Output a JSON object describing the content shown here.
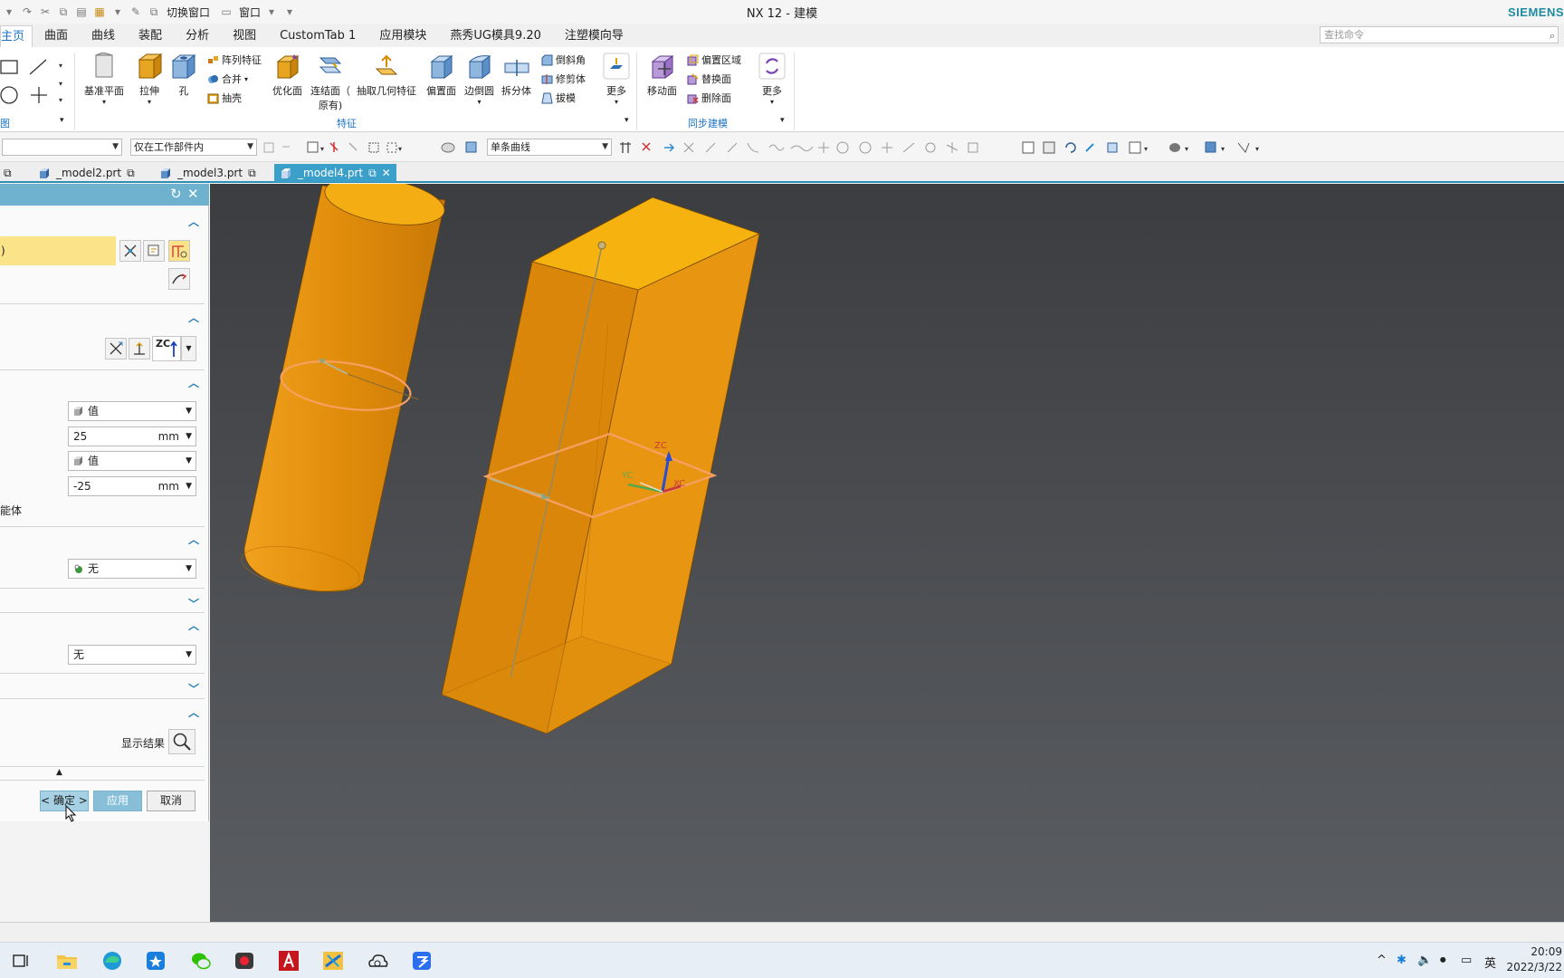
{
  "window": {
    "title": "NX 12 - 建模",
    "brand": "SIEMENS",
    "qa_switch_window": "切换窗口",
    "qa_window": "窗口"
  },
  "ribbon_tabs": [
    "主页",
    "曲面",
    "曲线",
    "装配",
    "分析",
    "视图",
    "CustomTab 1",
    "应用模块",
    "燕秀UG模具9.20",
    "注塑模向导"
  ],
  "command_search_placeholder": "查找命令",
  "ribbon": {
    "sketch_group_label": "图",
    "feature_group_label": "特征",
    "sync_group_label": "同步建模",
    "datum_plane": "基准平面",
    "extrude": "拉伸",
    "hole": "孔",
    "pattern_feature": "阵列特征",
    "unite": "合并",
    "shell": "抽壳",
    "optimize_face": "优化面",
    "chain_face_line1": "连结面（",
    "chain_face_line2": "原有)",
    "extract_geometry": "抽取几何特征",
    "offset_face": "偏置面",
    "edge_blend_face": "边倒圆",
    "split_body": "拆分体",
    "chamfer": "倒斜角",
    "trim_body": "修剪体",
    "draft": "拔模",
    "more": "更多",
    "move_face": "移动面",
    "offset_region": "偏置区域",
    "replace_face": "替换面",
    "delete_face": "删除面",
    "more2": "更多"
  },
  "toolbar": {
    "filter_scope": "仅在工作部件内",
    "curve_rule": "单条曲线"
  },
  "doc_tabs": [
    "_model2.prt",
    "_model3.prt",
    "_model4.prt"
  ],
  "dialog": {
    "selection_text": ")",
    "zc_label": "ZC",
    "start_type": "值",
    "start_distance": "25",
    "start_unit": "mm",
    "end_type": "值",
    "end_distance": "-25",
    "end_unit": "mm",
    "body_type_label": "能体",
    "boolean_value": "无",
    "draft_value": "无",
    "show_result": "显示结果",
    "ok": "< 确定 >",
    "apply": "应用",
    "cancel": "取消"
  },
  "viewport": {
    "triad_zc": "ZC",
    "triad_yc": "YC",
    "triad_xc": "XC"
  },
  "taskbar": {
    "ime": "英",
    "time": "20:09",
    "date": "2022/3/22"
  },
  "colors": {
    "accent": "#3a9fc9",
    "solid": "#e08a0a",
    "solid_top": "#f4b00c",
    "section_curve": "#f6a060",
    "highlight": "#fbe38a"
  }
}
